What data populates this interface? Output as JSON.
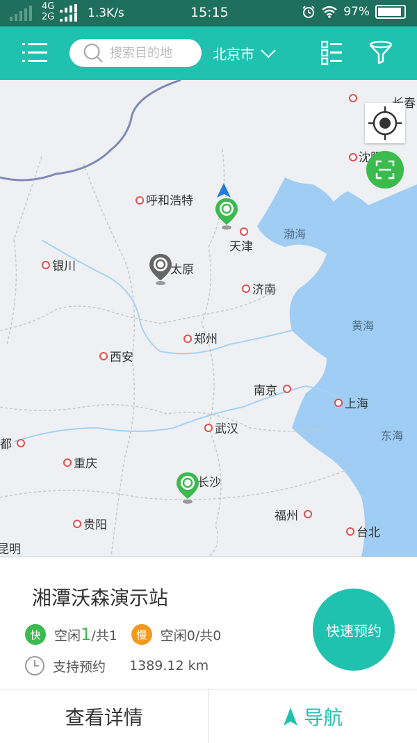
{
  "status_bar": {
    "network_top": "4G",
    "network_bottom": "2G",
    "speed": "1.3K/s",
    "time": "15:15",
    "battery": "97%",
    "battery_level": 0.97
  },
  "app_bar": {
    "search_placeholder": "搜索目的地",
    "city": "北京市"
  },
  "map": {
    "cities": [
      {
        "label": "长春"
      },
      {
        "label": "沈阳"
      },
      {
        "label": "呼和浩特"
      },
      {
        "label": "天津"
      },
      {
        "label": "银川"
      },
      {
        "label": "太原"
      },
      {
        "label": "济南"
      },
      {
        "label": "郑州"
      },
      {
        "label": "西安"
      },
      {
        "label": "南京"
      },
      {
        "label": "上海"
      },
      {
        "label": "武汉"
      },
      {
        "label": "都"
      },
      {
        "label": "重庆"
      },
      {
        "label": "长沙"
      },
      {
        "label": "福州"
      },
      {
        "label": "贵阳"
      },
      {
        "label": "台北"
      },
      {
        "label": "昆明"
      }
    ],
    "water": [
      {
        "label": "渤海"
      },
      {
        "label": "黄海"
      },
      {
        "label": "东海"
      }
    ]
  },
  "station": {
    "name": "湘潭沃森演示站",
    "fast_badge": "快",
    "fast_label_prefix": "空闲",
    "fast_free": "1",
    "fast_label_suffix": "/共1",
    "slow_badge": "慢",
    "slow_label": "空闲0/共0",
    "reservation": "支持预约",
    "distance": "1389.12 km",
    "quick_book": "快速预约"
  },
  "bottom": {
    "details": "查看详情",
    "navigate": "导航"
  },
  "colors": {
    "accent": "#21c1b0",
    "status_bar": "#1f6f5e",
    "fast_badge": "#3bba4e",
    "slow_badge": "#f39a1e",
    "map_land": "#eef0f3",
    "map_water": "#9fcdf4"
  }
}
